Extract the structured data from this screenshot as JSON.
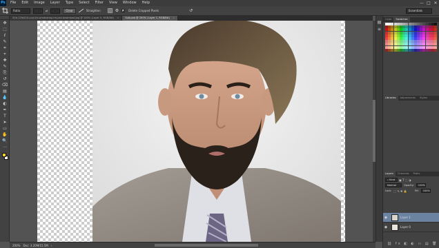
{
  "app": {
    "logo": "Ps"
  },
  "menu": [
    "File",
    "Edit",
    "Image",
    "Layer",
    "Type",
    "Select",
    "Filter",
    "View",
    "Window",
    "Help"
  ],
  "window_controls": {
    "minimize": "—",
    "maximize": "□",
    "close": "✕"
  },
  "options_bar": {
    "ratio_value": "Ratio",
    "clear_label": "Clear",
    "straighten_label": "Straighten",
    "delete_cropped_label": "Delete Cropped Pixels",
    "delete_cropped_checked": true,
    "workspace": "Essentials"
  },
  "tabs": [
    {
      "label": "52b-12fd424-cool-for-photoshop-hd-psd-download.jpg @ 100% (Layer 0, RGB/8#)",
      "close": "×",
      "active": false
    },
    {
      "label": "Suit.psb @ 200% (Layer 1, RGB/8#)",
      "close": "×",
      "active": true
    }
  ],
  "tools": [
    "move-icon",
    "marquee-icon",
    "lasso-icon",
    "quick-select-icon",
    "crop-icon",
    "eyedropper-icon",
    "healing-icon",
    "brush-icon",
    "stamp-icon",
    "history-brush-icon",
    "eraser-icon",
    "gradient-icon",
    "blur-icon",
    "dodge-icon",
    "pen-icon",
    "type-icon",
    "path-select-icon",
    "shape-icon",
    "hand-icon",
    "zoom-icon",
    "more-tools-icon"
  ],
  "colors": {
    "foreground": "#e6cf2a",
    "background": "#ffffff",
    "selected_layer": "#6b82a0"
  },
  "status": {
    "zoom": "200%",
    "doc": "Doc: 3.20M/15.5M"
  },
  "panels": {
    "color_tabs": [
      "Color",
      "Swatches"
    ],
    "libraries_tabs": [
      "Libraries",
      "Adjustments",
      "Styles"
    ],
    "layers_tabs": [
      "Layers",
      "Channels",
      "Paths"
    ],
    "kind_label": "Kind",
    "blend_mode": "Normal",
    "opacity_label": "Opacity:",
    "opacity_value": "100%",
    "lock_label": "Lock:",
    "fill_label": "Fill:",
    "fill_value": "100%",
    "layers": [
      {
        "name": "Layer 1",
        "selected": true
      },
      {
        "name": "Layer 0",
        "selected": false
      }
    ]
  }
}
